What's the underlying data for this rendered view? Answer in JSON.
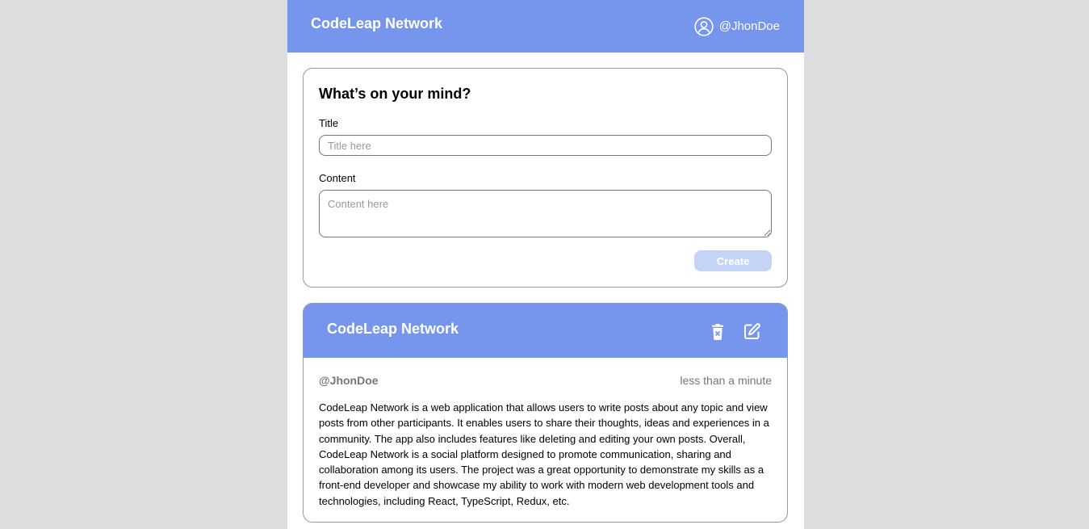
{
  "header": {
    "title": "CodeLeap Network",
    "username": "@JhonDoe",
    "user_icon": "user-circle-icon"
  },
  "create_post": {
    "heading": "What’s on your mind?",
    "title_label": "Title",
    "title_placeholder": "Title here",
    "title_value": "",
    "content_label": "Content",
    "content_placeholder": "Content here",
    "content_value": "",
    "create_label": "Create",
    "create_enabled": false
  },
  "posts": [
    {
      "title": "CodeLeap Network",
      "author": "@JhonDoe",
      "time": "less than a minute",
      "content": "CodeLeap Network is a web application that allows users to write posts about any topic and view posts from other participants. It enables users to share their thoughts, ideas and experiences in a community. The app also includes features like deleting and editing your own posts. Overall, CodeLeap Network is a social platform designed to promote communication, sharing and collaboration among its users. The project was a great opportunity to demonstrate my skills as a front-end developer and showcase my ability to work with modern web development tools and technologies, including React, TypeScript, Redux, etc.",
      "delete_icon": "trash-icon",
      "edit_icon": "edit-icon"
    }
  ],
  "colors": {
    "brand": "#7695ec",
    "button_disabled": "#c5d3f7",
    "background": "#dddddd",
    "muted_text": "#777777"
  }
}
